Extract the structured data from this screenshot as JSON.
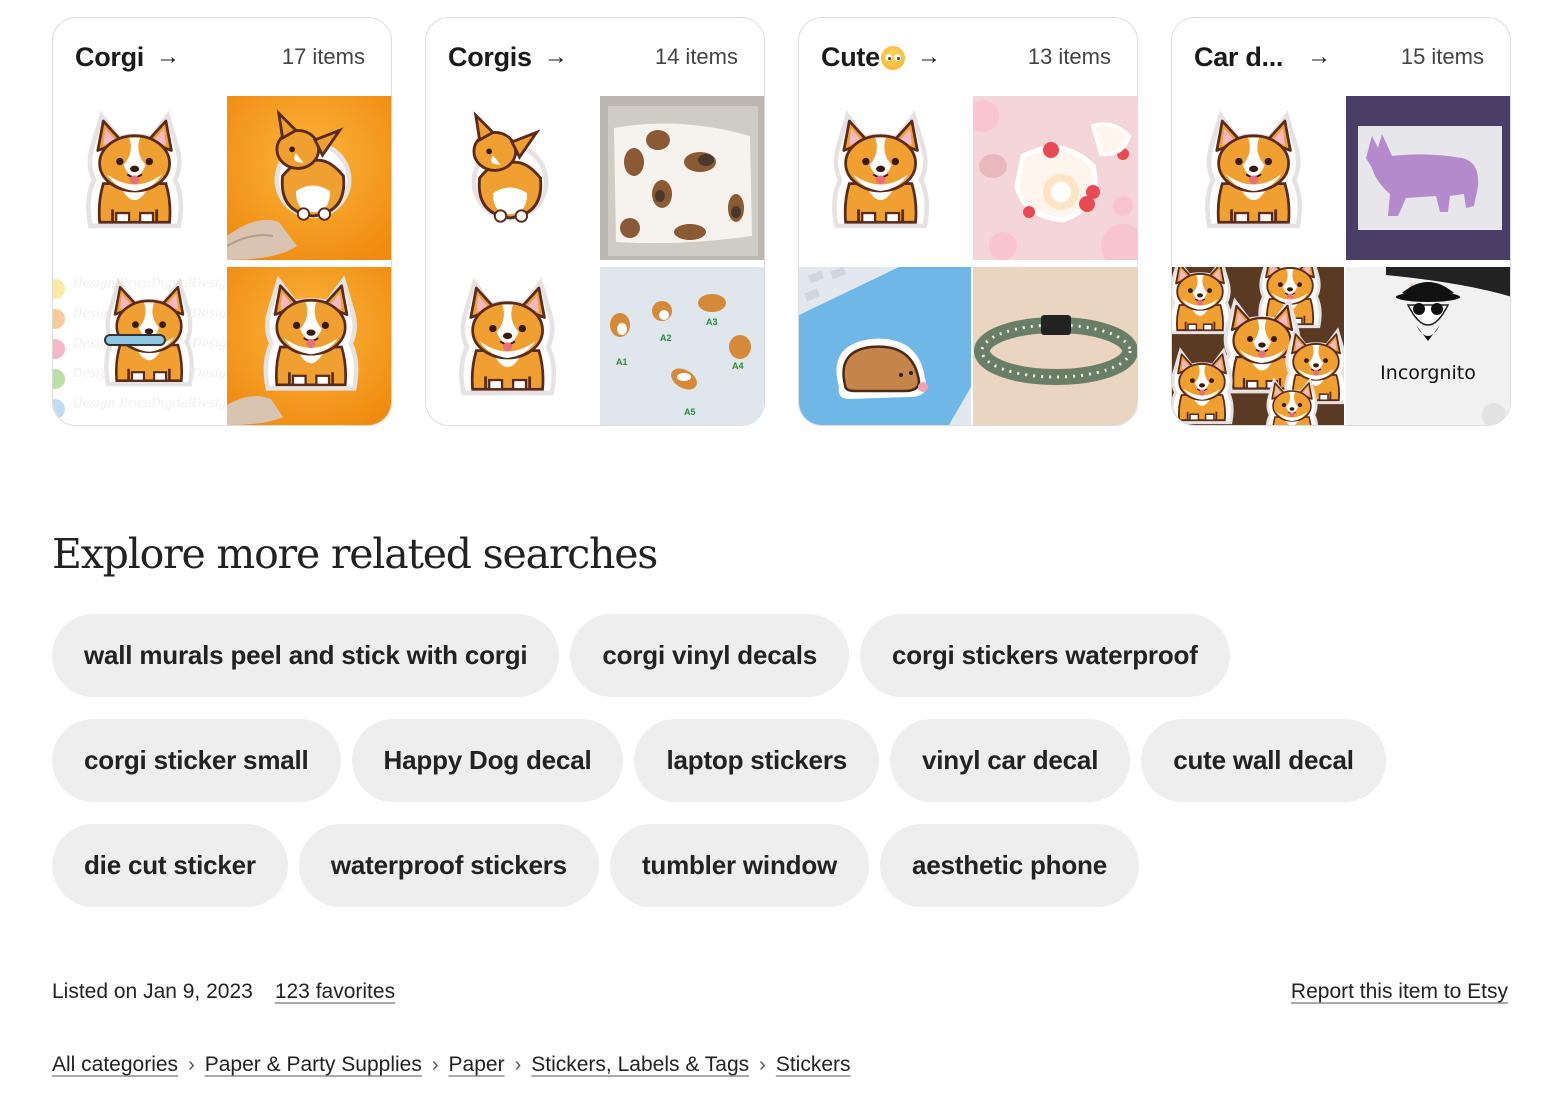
{
  "collections": [
    {
      "title": "Corgi",
      "title_emoji": "",
      "count": "17 items",
      "arrow": "→",
      "images": [
        "corgi-sticker-sitting",
        "corgi-butt-sticker-orange-bg",
        "corgi-holding-bone-clipart",
        "corgi-peace-sign-sticker-orange-bg"
      ]
    },
    {
      "title": "Corgis",
      "title_emoji": "",
      "count": "14 items",
      "arrow": "→",
      "images": [
        "corgi-butt-sticker",
        "corgi-print-face-mask",
        "corgi-sticker-sitting",
        "miniature-corgi-figurines"
      ]
    },
    {
      "title": "Cute",
      "title_emoji": "pleading-face-emoji",
      "count": "13 items",
      "arrow": "→",
      "images": [
        "corgi-sticker-sitting",
        "strawberry-roll-cake-stickers",
        "sleeping-bear-sticker-on-blue",
        "floral-dog-collar"
      ]
    },
    {
      "title": "Car d...",
      "title_emoji": "",
      "count": "15 items",
      "arrow": "→",
      "images": [
        "corgi-sticker-sitting",
        "purple-corgi-silhouette-decal",
        "pile-of-corgi-stickers",
        "incorgnito-laptop-sticker"
      ]
    }
  ],
  "image_text": {
    "figurine_labels": [
      "A1",
      "A2",
      "A3",
      "A4",
      "A5"
    ],
    "incorgnito": "Incorgnito"
  },
  "related": {
    "title": "Explore more related searches",
    "chips": [
      "wall murals peel and stick with corgi",
      "corgi vinyl decals",
      "corgi stickers waterproof",
      "corgi sticker small",
      "Happy Dog decal",
      "laptop stickers",
      "vinyl car decal",
      "cute wall decal",
      "die cut sticker",
      "waterproof stickers",
      "tumbler window",
      "aesthetic phone"
    ]
  },
  "listing": {
    "listed_on": "Listed on Jan 9, 2023",
    "favorites": "123 favorites",
    "report": "Report this item to Etsy"
  },
  "breadcrumb": {
    "separator": "›",
    "items": [
      "All categories",
      "Paper & Party Supplies",
      "Paper",
      "Stickers, Labels & Tags",
      "Stickers"
    ]
  },
  "colors": {
    "chip_bg": "#eeeeee",
    "card_border": "#dcdcdc",
    "text": "#222222",
    "corgi_orange": "#f0a030"
  }
}
